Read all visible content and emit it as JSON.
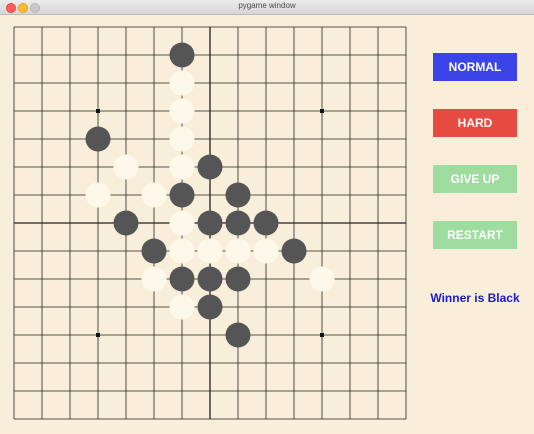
{
  "window": {
    "title": "pygame window"
  },
  "buttons": [
    {
      "id": "normal",
      "label": "NORMAL",
      "color": "#3b44e6"
    },
    {
      "id": "hard",
      "label": "HARD",
      "color": "#e64a40"
    },
    {
      "id": "give-up",
      "label": "GIVE UP",
      "color": "#9fdc9f"
    },
    {
      "id": "restart",
      "label": "RESTART",
      "color": "#9fdc9f"
    }
  ],
  "status": {
    "text": "Winner is Black",
    "color": "#1a1ad4"
  },
  "board": {
    "size": 15,
    "background": "#f9eed9",
    "star_points": [
      [
        3,
        3
      ],
      [
        11,
        3
      ],
      [
        3,
        11
      ],
      [
        11,
        11
      ]
    ],
    "black_color": "#555555",
    "white_color": "#fdf8ea",
    "stones": [
      {
        "c": 6,
        "r": 1,
        "color": "black"
      },
      {
        "c": 6,
        "r": 2,
        "color": "white"
      },
      {
        "c": 6,
        "r": 3,
        "color": "white"
      },
      {
        "c": 3,
        "r": 4,
        "color": "black"
      },
      {
        "c": 6,
        "r": 4,
        "color": "white"
      },
      {
        "c": 4,
        "r": 5,
        "color": "white"
      },
      {
        "c": 6,
        "r": 5,
        "color": "white"
      },
      {
        "c": 7,
        "r": 5,
        "color": "black"
      },
      {
        "c": 3,
        "r": 6,
        "color": "white"
      },
      {
        "c": 5,
        "r": 6,
        "color": "white"
      },
      {
        "c": 6,
        "r": 6,
        "color": "black"
      },
      {
        "c": 8,
        "r": 6,
        "color": "black"
      },
      {
        "c": 4,
        "r": 7,
        "color": "black"
      },
      {
        "c": 6,
        "r": 7,
        "color": "white"
      },
      {
        "c": 7,
        "r": 7,
        "color": "black"
      },
      {
        "c": 8,
        "r": 7,
        "color": "black"
      },
      {
        "c": 9,
        "r": 7,
        "color": "black"
      },
      {
        "c": 5,
        "r": 8,
        "color": "black"
      },
      {
        "c": 6,
        "r": 8,
        "color": "white"
      },
      {
        "c": 7,
        "r": 8,
        "color": "white"
      },
      {
        "c": 8,
        "r": 8,
        "color": "white"
      },
      {
        "c": 9,
        "r": 8,
        "color": "white"
      },
      {
        "c": 10,
        "r": 8,
        "color": "black"
      },
      {
        "c": 5,
        "r": 9,
        "color": "white"
      },
      {
        "c": 6,
        "r": 9,
        "color": "black"
      },
      {
        "c": 7,
        "r": 9,
        "color": "black"
      },
      {
        "c": 8,
        "r": 9,
        "color": "black"
      },
      {
        "c": 11,
        "r": 9,
        "color": "white"
      },
      {
        "c": 6,
        "r": 10,
        "color": "white"
      },
      {
        "c": 7,
        "r": 10,
        "color": "black"
      },
      {
        "c": 8,
        "r": 11,
        "color": "black"
      }
    ]
  }
}
